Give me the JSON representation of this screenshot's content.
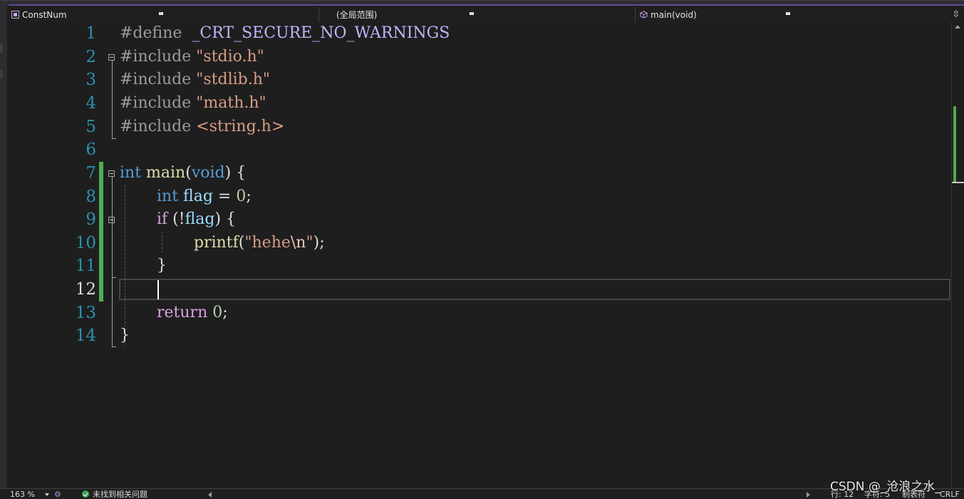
{
  "navbar": {
    "project": "ConstNum",
    "scope": "(全局范围)",
    "member": "main(void)"
  },
  "line_numbers": [
    "1",
    "2",
    "3",
    "4",
    "5",
    "6",
    "7",
    "8",
    "9",
    "10",
    "11",
    "12",
    "13",
    "14"
  ],
  "active_line": "12",
  "code": {
    "l1": {
      "directive": "#define",
      "macro": "_CRT_SECURE_NO_WARNINGS"
    },
    "l2": {
      "directive": "#include",
      "file": "\"stdio.h\""
    },
    "l3": {
      "directive": "#include",
      "file": "\"stdlib.h\""
    },
    "l4": {
      "directive": "#include",
      "file": "\"math.h\""
    },
    "l5": {
      "directive": "#include",
      "file": "<string.h>"
    },
    "l7": {
      "kw": "int",
      "fn": "main",
      "open": "(",
      "param": "void",
      "close": ") {"
    },
    "l8": {
      "kw": "int",
      "var": "flag",
      "op": " = ",
      "num": "0",
      "end": ";"
    },
    "l9": {
      "kw": "if",
      "open": " (!",
      "var": "flag",
      "close": ") {"
    },
    "l10": {
      "fn": "printf",
      "open": "(",
      "str1": "\"hehe",
      "esc": "\\n",
      "str2": "\"",
      "close": ");"
    },
    "l11": {
      "brace": "}"
    },
    "l13": {
      "kw": "return",
      "num": "0",
      "end": ";"
    },
    "l14": {
      "brace": "}"
    }
  },
  "status": {
    "zoom": "163 %",
    "issues": "未找到相关问题",
    "line": "行: 12",
    "char": "字符: 5",
    "tabs": "制表符",
    "eol": "CRLF"
  },
  "watermark": "CSDN @_沧浪之水_",
  "colors": {
    "keyword": "#569cd6",
    "control": "#d8a0df",
    "function": "#dcdcaa",
    "variable": "#9cdcfe",
    "string": "#d69d85",
    "number": "#b5cea8",
    "line_number": "#2b91af",
    "change_bar": "#4caf50"
  }
}
